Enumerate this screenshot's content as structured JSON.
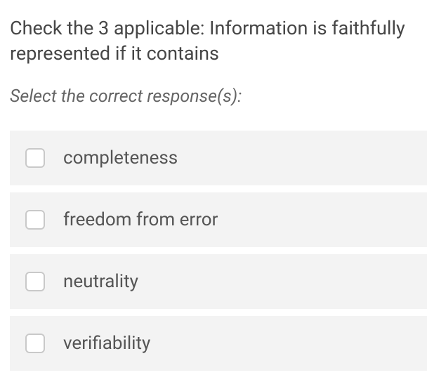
{
  "question": "Check the 3 applicable: Information is faithfully represented if it contains",
  "prompt": "Select the correct response(s):",
  "options": [
    {
      "label": "completeness"
    },
    {
      "label": "freedom from error"
    },
    {
      "label": "neutrality"
    },
    {
      "label": "verifiability"
    }
  ]
}
